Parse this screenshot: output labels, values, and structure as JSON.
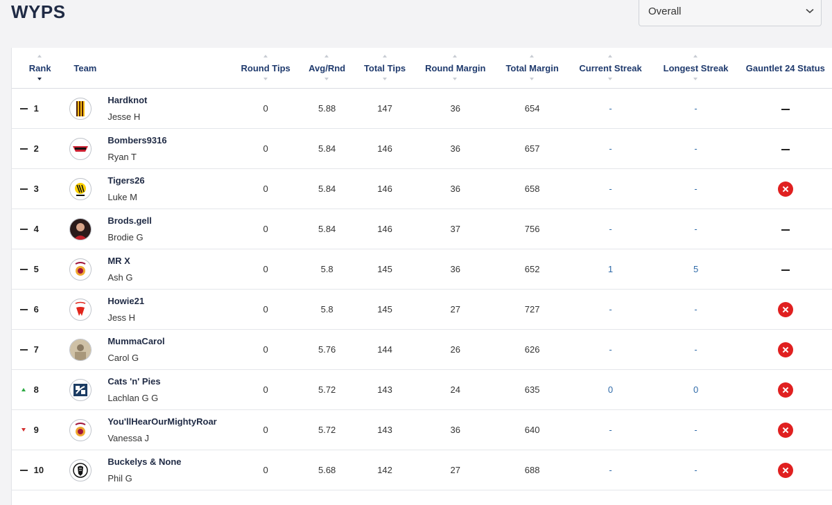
{
  "page": {
    "title": "WYPS"
  },
  "view_select": {
    "value": "Overall"
  },
  "columns": {
    "rank": "Rank",
    "team": "Team",
    "round_tips": "Round Tips",
    "avg_rnd": "Avg/Rnd",
    "total_tips": "Total Tips",
    "round_margin": "Round Margin",
    "total_margin": "Total Margin",
    "current_streak": "Current Streak",
    "longest_streak": "Longest Streak",
    "gauntlet_status": "Gauntlet 24 Status"
  },
  "rows": [
    {
      "rank": "1",
      "change": "none",
      "logo": "hawthorn-logo",
      "team": "Hardknot",
      "user": "Jesse H",
      "round_tips": "0",
      "avg_rnd": "5.88",
      "total_tips": "147",
      "round_margin": "36",
      "total_margin": "654",
      "current_streak": "-",
      "longest_streak": "-",
      "status": "dash"
    },
    {
      "rank": "2",
      "change": "none",
      "logo": "essendon-logo",
      "team": "Bombers9316",
      "user": "Ryan T",
      "round_tips": "0",
      "avg_rnd": "5.84",
      "total_tips": "146",
      "round_margin": "36",
      "total_margin": "657",
      "current_streak": "-",
      "longest_streak": "-",
      "status": "dash"
    },
    {
      "rank": "3",
      "change": "none",
      "logo": "richmond-logo",
      "team": "Tigers26",
      "user": "Luke M",
      "round_tips": "0",
      "avg_rnd": "5.84",
      "total_tips": "146",
      "round_margin": "36",
      "total_margin": "658",
      "current_streak": "-",
      "longest_streak": "-",
      "status": "eliminated"
    },
    {
      "rank": "4",
      "change": "none",
      "logo": "player-photo",
      "team": "Brods.gell",
      "user": "Brodie G",
      "round_tips": "0",
      "avg_rnd": "5.84",
      "total_tips": "146",
      "round_margin": "37",
      "total_margin": "756",
      "current_streak": "-",
      "longest_streak": "-",
      "status": "dash"
    },
    {
      "rank": "5",
      "change": "none",
      "logo": "brisbane-logo",
      "team": "MR X",
      "user": "Ash G",
      "round_tips": "0",
      "avg_rnd": "5.8",
      "total_tips": "145",
      "round_margin": "36",
      "total_margin": "652",
      "current_streak": "1",
      "longest_streak": "5",
      "status": "dash"
    },
    {
      "rank": "6",
      "change": "none",
      "logo": "sydney-logo",
      "team": "Howie21",
      "user": "Jess H",
      "round_tips": "0",
      "avg_rnd": "5.8",
      "total_tips": "145",
      "round_margin": "27",
      "total_margin": "727",
      "current_streak": "-",
      "longest_streak": "-",
      "status": "eliminated"
    },
    {
      "rank": "7",
      "change": "none",
      "logo": "vintage-photo",
      "team": "MummaCarol",
      "user": "Carol G",
      "round_tips": "0",
      "avg_rnd": "5.76",
      "total_tips": "144",
      "round_margin": "26",
      "total_margin": "626",
      "current_streak": "-",
      "longest_streak": "-",
      "status": "eliminated"
    },
    {
      "rank": "8",
      "change": "up",
      "logo": "geelong-logo",
      "team": "Cats 'n' Pies",
      "user": "Lachlan G G",
      "round_tips": "0",
      "avg_rnd": "5.72",
      "total_tips": "143",
      "round_margin": "24",
      "total_margin": "635",
      "current_streak": "0",
      "longest_streak": "0",
      "status": "eliminated"
    },
    {
      "rank": "9",
      "change": "down",
      "logo": "brisbane-logo",
      "team": "You'llHearOurMightyRoar",
      "user": "Vanessa J",
      "round_tips": "0",
      "avg_rnd": "5.72",
      "total_tips": "143",
      "round_margin": "36",
      "total_margin": "640",
      "current_streak": "-",
      "longest_streak": "-",
      "status": "eliminated"
    },
    {
      "rank": "10",
      "change": "none",
      "logo": "collingwood-logo",
      "team": "Buckelys & None",
      "user": "Phil G",
      "round_tips": "0",
      "avg_rnd": "5.68",
      "total_tips": "142",
      "round_margin": "27",
      "total_margin": "688",
      "current_streak": "-",
      "longest_streak": "-",
      "status": "eliminated"
    }
  ]
}
